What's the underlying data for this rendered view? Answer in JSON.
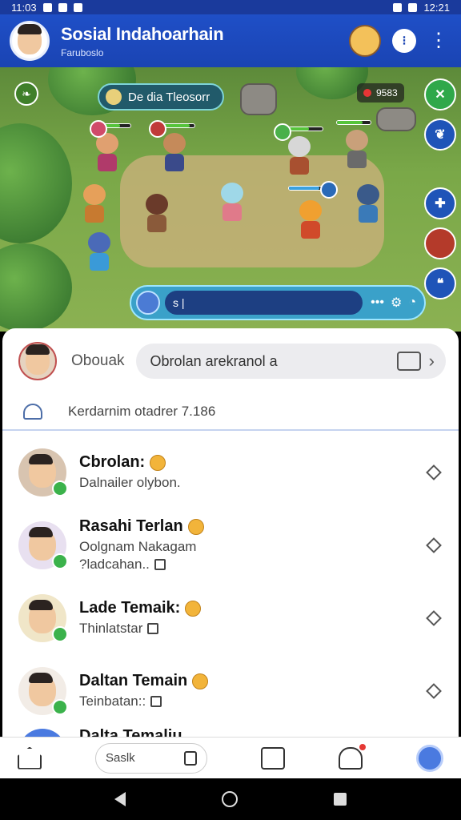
{
  "status_bar": {
    "left_text": "11:03",
    "right_text": "12:21"
  },
  "app_bar": {
    "title": "Sosial Indahoarhain",
    "subtitle": "Faruboslo",
    "kebab_glyph": "⋮",
    "round_btn_glyph": "⁝"
  },
  "game": {
    "location_label": "De dia Tleosorr",
    "score_text": "9583",
    "leaf_glyph": "❧",
    "chat_input": {
      "value": "s |",
      "placeholder": ""
    },
    "side_buttons": [
      {
        "name": "close-side-button",
        "glyph": "✕",
        "color": "#2fa84a"
      },
      {
        "name": "bird-side-button",
        "glyph": "❦",
        "color": "#1f54b8"
      },
      {
        "name": "fox-side-button",
        "glyph": "✚",
        "color": "#1f54b8"
      },
      {
        "name": "avatar-side-button",
        "glyph": "",
        "color": "#b43a2a"
      },
      {
        "name": "quote-side-button",
        "glyph": "❝",
        "color": "#1f54b8"
      }
    ]
  },
  "chat_panel": {
    "header_label": "Obouak",
    "search_value": "Obrolan arekranol a",
    "notice": "Kerdarnim otadrer 7.186",
    "items": [
      {
        "name": "Cbrolan:",
        "line1": "Dalnailer olybon.",
        "line2": ""
      },
      {
        "name": "Rasahi Terlan",
        "line1": "Oolgnam Nakagam",
        "line2": "?ladcahan.."
      },
      {
        "name": "Lade Temaik:",
        "line1": "Thinlatstar",
        "line2": ""
      },
      {
        "name": "Daltan Temain",
        "line1": "Teinbatan::",
        "line2": ""
      }
    ],
    "partial_item": "Dalta Temaliu"
  },
  "bottom_nav": {
    "search_value": "Saslk"
  },
  "colors": {
    "primary": "#1f4fc7",
    "online": "#3bb24b",
    "notif": "#e53935"
  }
}
